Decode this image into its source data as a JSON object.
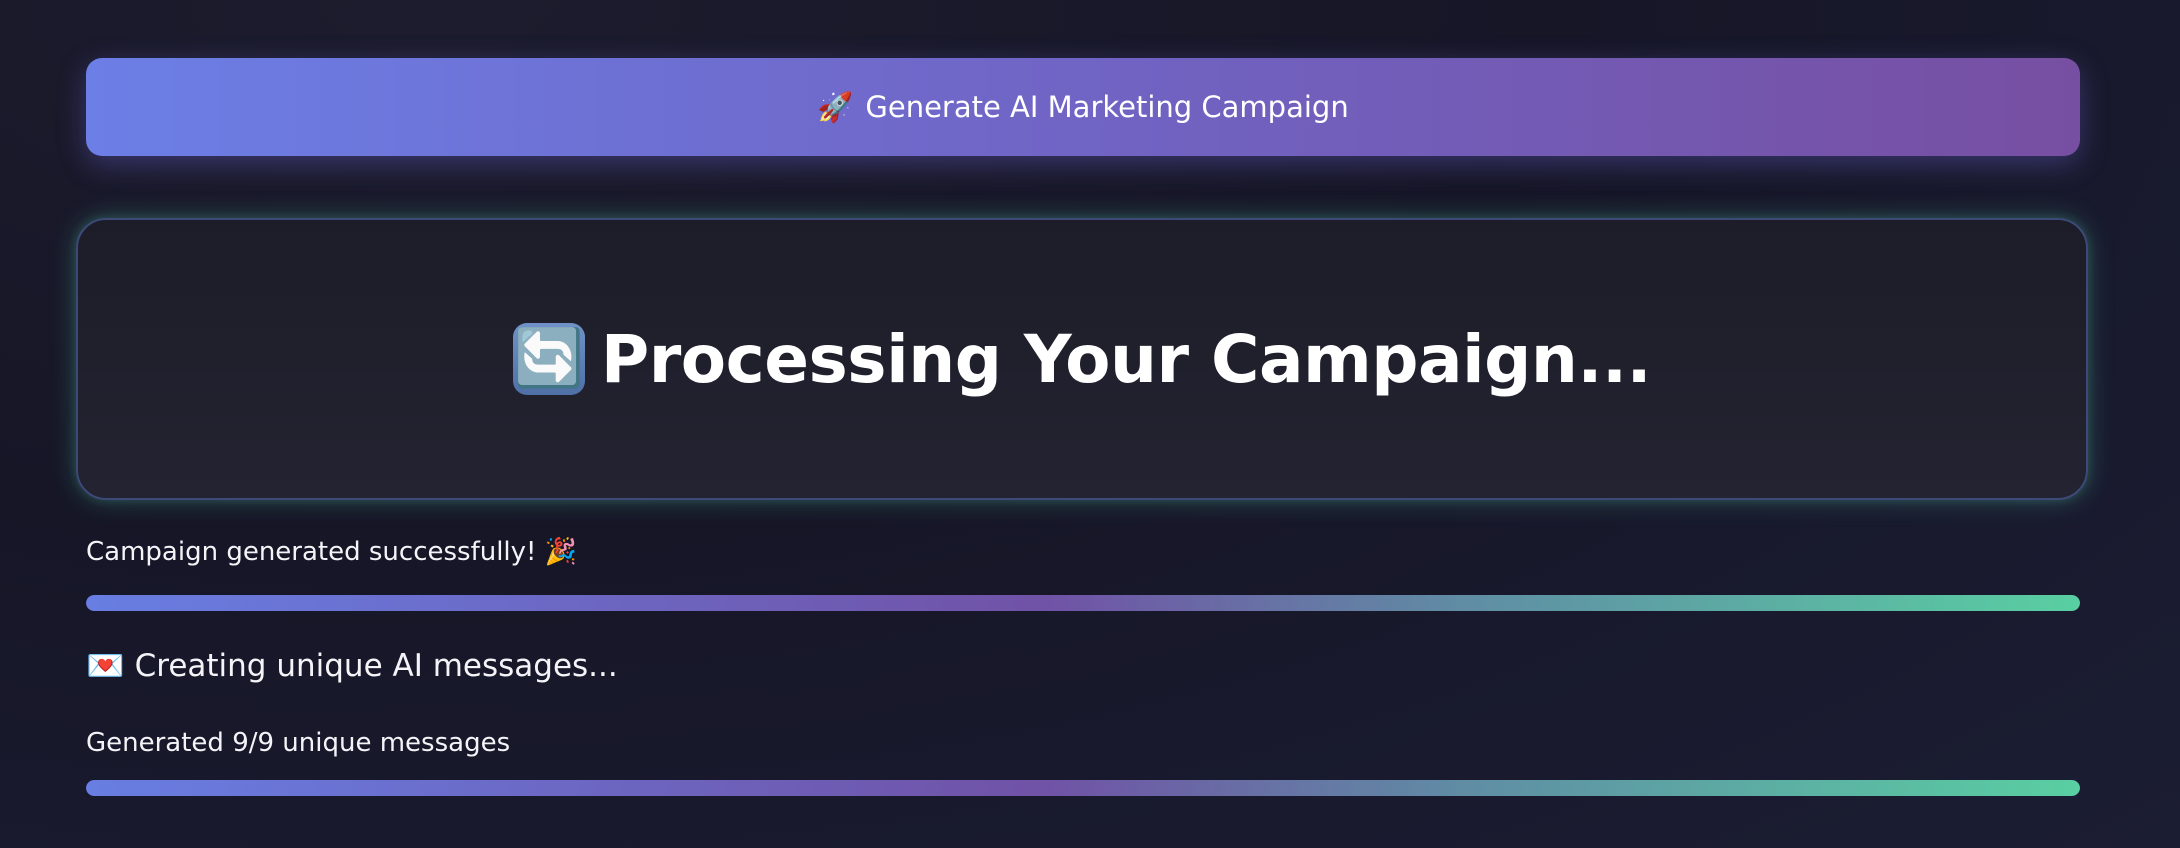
{
  "header": {
    "generate_button_label": "Generate AI Marketing Campaign",
    "generate_button_icon": "🚀"
  },
  "processing": {
    "icon": "🔄",
    "title": "Processing Your Campaign..."
  },
  "campaign_status": {
    "label": "Campaign generated successfully!",
    "emoji": "🎉",
    "progress": 1.0
  },
  "messages": {
    "icon": "💌",
    "heading": "Creating unique AI messages...",
    "progress_label": "Generated 9/9 unique messages",
    "progress": 1.0
  },
  "colors": {
    "button_gradient_start": "#6c7fe6",
    "button_gradient_end": "#774fa2",
    "accent_green": "#59cfa2",
    "background": "#161627"
  }
}
